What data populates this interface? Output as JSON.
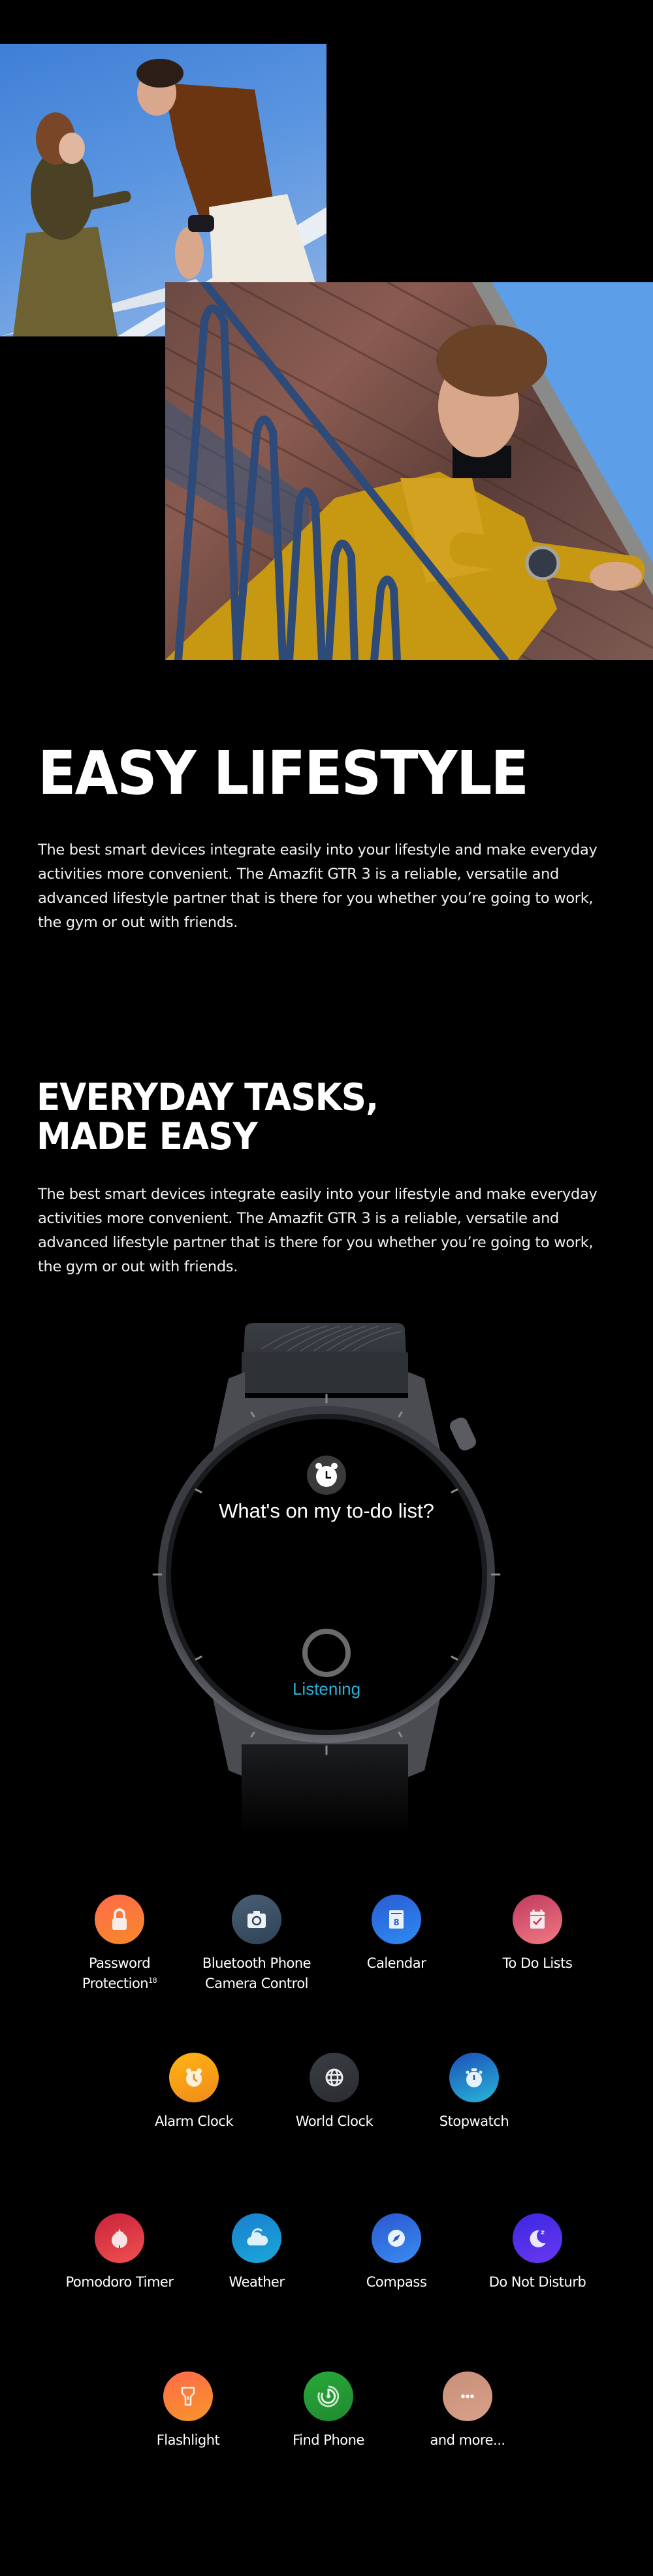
{
  "photos": [
    {
      "alt": "couple-on-bridge-photo"
    },
    {
      "alt": "man-on-balcony-photo"
    }
  ],
  "section_lifestyle": {
    "title": "EASY LIFESTYLE",
    "body": "The best smart devices integrate easily into your lifestyle and make everyday activities more convenient. The Amazfit GTR 3 is a reliable, versatile and advanced lifestyle partner that is there for you whether you’re going to work, the gym or out with friends."
  },
  "section_tasks": {
    "title_line1": "EVERYDAY TASKS,",
    "title_line2": "MADE EASY",
    "body": "The best smart devices integrate easily into your lifestyle and make everyday activities more convenient. The Amazfit GTR 3 is a reliable, versatile and advanced lifestyle partner that is there for you whether you’re going to work, the gym or out with friends."
  },
  "watch": {
    "question": "What's on my to-do list?",
    "status": "Listening",
    "status_color": "#2ab0d6"
  },
  "features": [
    {
      "label": "Password",
      "label2": "Protection",
      "sup": "18",
      "icon": "lock-icon",
      "colors": [
        "#ff6a4a",
        "#f58a2a"
      ]
    },
    {
      "label": "Bluetooth Phone",
      "label2": "Camera Control",
      "icon": "camera-icon",
      "colors": [
        "#4a5e74",
        "#2f4358"
      ]
    },
    {
      "label": "Calendar",
      "icon": "calendar-icon",
      "colors": [
        "#2a5bd6",
        "#2f8bf0"
      ]
    },
    {
      "label": "To Do Lists",
      "icon": "checklist-icon",
      "colors": [
        "#c03a5e",
        "#f07a84"
      ]
    },
    {
      "label": "Alarm Clock",
      "icon": "alarm-clock-icon",
      "colors": [
        "#ffb414",
        "#f08a1a"
      ]
    },
    {
      "label": "World Clock",
      "icon": "globe-icon",
      "colors": [
        "#3a3d44",
        "#2a2c31"
      ]
    },
    {
      "label": "Stopwatch",
      "icon": "stopwatch-icon",
      "colors": [
        "#1c4fb8",
        "#28b6d8"
      ]
    },
    {
      "label": "Pomodoro Timer",
      "icon": "tomato-icon",
      "colors": [
        "#c8243a",
        "#f05050"
      ]
    },
    {
      "label": "Weather",
      "icon": "cloud-icon",
      "colors": [
        "#1a7fd0",
        "#1aa8d8"
      ]
    },
    {
      "label": "Compass",
      "icon": "compass-icon",
      "colors": [
        "#2a58d0",
        "#3a8cf0"
      ]
    },
    {
      "label": "Do Not Disturb",
      "icon": "moon-icon",
      "colors": [
        "#3a28e0",
        "#6a38f0"
      ]
    },
    {
      "label": "Flashlight",
      "icon": "flashlight-icon",
      "colors": [
        "#ff6a4a",
        "#f5962a"
      ]
    },
    {
      "label": "Find Phone",
      "icon": "find-phone-icon",
      "colors": [
        "#2aa83a",
        "#1f8a30"
      ]
    },
    {
      "label": "and more...",
      "icon": "more-icon",
      "colors": [
        "#c8907a",
        "#d8a088"
      ]
    }
  ]
}
